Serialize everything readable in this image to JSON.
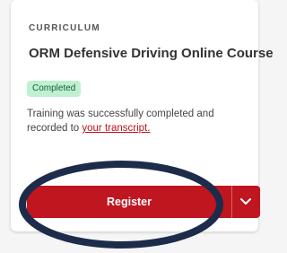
{
  "card": {
    "eyebrow": "CURRICULUM",
    "title": "ORM Defensive Driving Online Course",
    "status_badge": "Completed",
    "message_prefix": "Training was successfully completed and recorded to ",
    "message_link": "your transcript.",
    "register_label": "Register"
  },
  "colors": {
    "brand_red": "#bf1620",
    "badge_bg": "#bff0d2",
    "badge_text": "#1a5e3a",
    "annotation_ring": "#1c2c4a"
  },
  "icons": {
    "dropdown": "chevron-down-icon"
  }
}
